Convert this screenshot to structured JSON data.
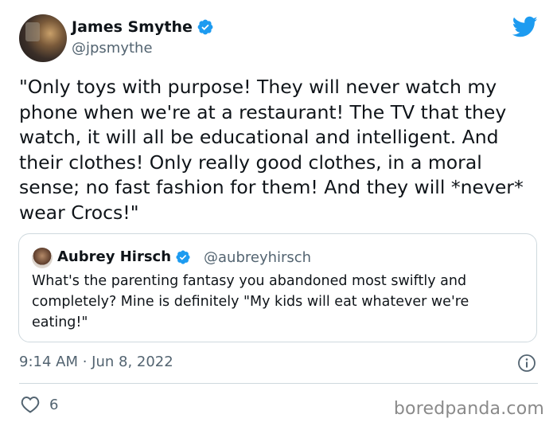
{
  "tweet": {
    "author": {
      "name": "James Smythe",
      "handle": "@jpsmythe",
      "verified": true
    },
    "text": "\"Only toys with purpose! They will never watch my phone when we're at a restaurant! The TV that they watch, it will all be educational and intelligent. And their clothes! Only really good clothes, in a moral sense; no fast fashion for them! And they will *never* wear Crocs!\"",
    "quoted_tweet": {
      "author_name": "Aubrey Hirsch",
      "author_handle": "@aubreyhirsch",
      "verified": true,
      "text": "What's the parenting fantasy you abandoned most swiftly and completely? Mine is definitely \"My kids will eat whatever we're eating!\""
    },
    "timestamp": "9:14 AM · Jun 8, 2022",
    "like_count": "6"
  },
  "watermark": "boredpanda.com",
  "icons": {
    "brand": "twitter-bird-icon",
    "verified": "verified-badge-icon",
    "info": "info-icon",
    "like": "heart-icon"
  },
  "colors": {
    "twitter_blue": "#1d9bf0",
    "text_primary": "#0f1419",
    "text_secondary": "#536471",
    "border": "#cfd9de"
  }
}
